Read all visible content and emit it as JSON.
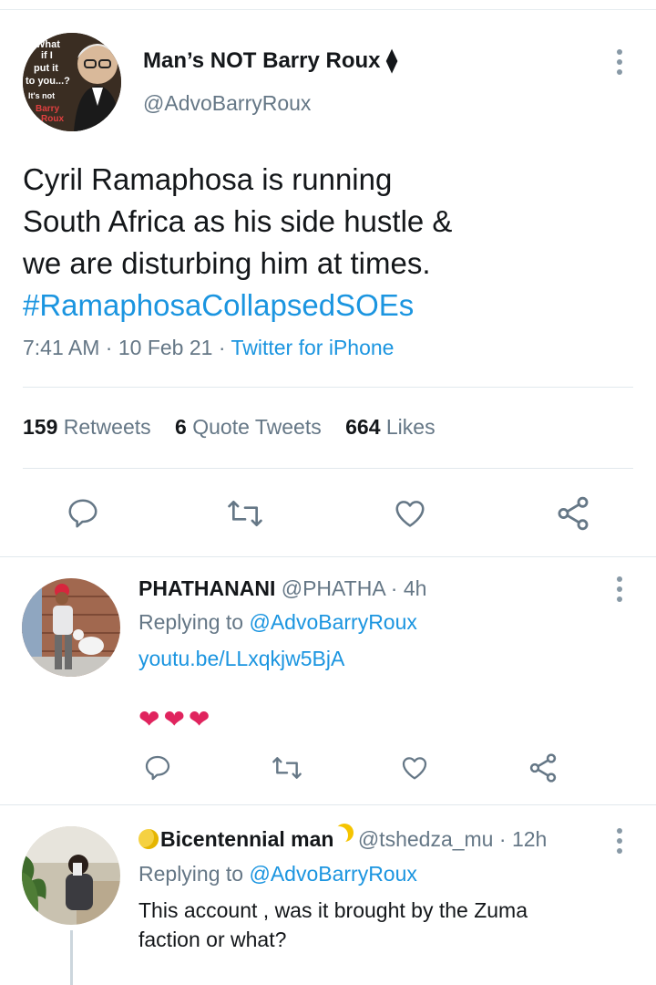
{
  "tweet": {
    "display_name": "Man’s NOT Barry Roux ⧫",
    "handle": "@AdvoBarryRoux",
    "text_lines": [
      "Cyril Ramaphosa is running",
      "South Africa as his side hustle &",
      "we are disturbing him at times."
    ],
    "hashtag": "#RamaphosaCollapsedSOEs",
    "time": "7:41 AM",
    "date": "10 Feb 21",
    "source": "Twitter for iPhone",
    "avatar_text": [
      "What",
      "if I",
      "put it",
      "to you...?",
      "It's not",
      "Barry",
      "Roux"
    ]
  },
  "stats": {
    "retweets_count": "159",
    "retweets_label": "Retweets",
    "quotes_count": "6",
    "quotes_label": "Quote Tweets",
    "likes_count": "664",
    "likes_label": "Likes"
  },
  "replies": [
    {
      "name": "PHATHANANI",
      "handle": "@PHATHA",
      "time": "4h",
      "replying_prefix": "Replying to",
      "replying_to": "@AdvoBarryRoux",
      "link": "youtu.be/LLxqkjw5BjA",
      "hearts": "❤❤❤"
    },
    {
      "name": "Bicentennial man",
      "handle": "@tshedza_mu",
      "time": "12h",
      "replying_prefix": "Replying to",
      "replying_to": "@AdvoBarryRoux",
      "text_lines": [
        "This account , was it brought by the Zuma",
        "faction or what?"
      ]
    }
  ],
  "colors": {
    "accent": "#1b95e0",
    "secondary_text": "#657786",
    "icon": "#657786",
    "heart": "#e0245e"
  },
  "icons": [
    "reply-icon",
    "retweet-icon",
    "like-icon",
    "share-icon",
    "more-icon"
  ]
}
